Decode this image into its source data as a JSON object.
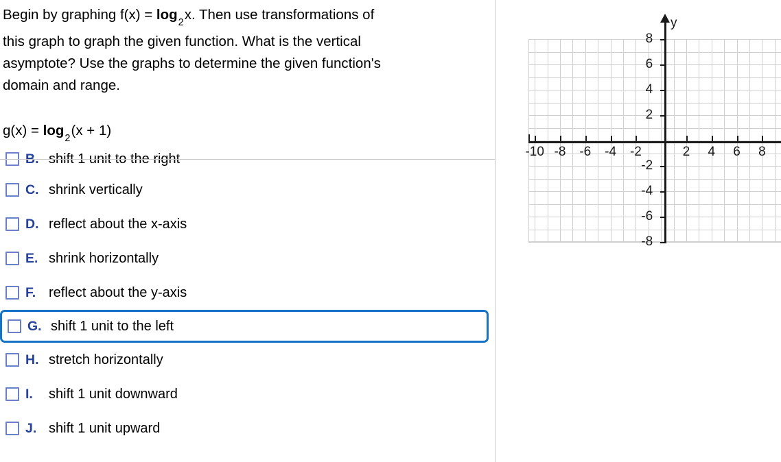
{
  "question": {
    "lines": [
      "Begin by graphing f(x) = ",
      "log",
      "2",
      "x. Then use transformations of",
      "this graph to graph the given function. What is the vertical",
      "asymptote? Use the graphs to determine the given function's",
      "domain and range."
    ],
    "line1_a": "Begin by graphing f(x) = ",
    "line1_log": "log",
    "line1_sub": "2",
    "line1_b": "x. Then use transformations of",
    "line2": "this graph to graph the given function. What is the vertical",
    "line3": "asymptote? Use the graphs to determine the given function's",
    "line4": "domain and range."
  },
  "given_function": {
    "prefix": "g(x) = ",
    "log": "log",
    "base": "2",
    "suffix": "(x + 1)"
  },
  "options": [
    {
      "letter": "B.",
      "label": "shift 1 unit to the right",
      "checked": false,
      "highlighted": false,
      "clipped": true
    },
    {
      "letter": "C.",
      "label": "shrink vertically",
      "checked": false,
      "highlighted": false,
      "clipped": false
    },
    {
      "letter": "D.",
      "label": "reflect about the x-axis",
      "checked": false,
      "highlighted": false,
      "clipped": false
    },
    {
      "letter": "E.",
      "label": "shrink horizontally",
      "checked": false,
      "highlighted": false,
      "clipped": false
    },
    {
      "letter": "F.",
      "label": "reflect about the y-axis",
      "checked": false,
      "highlighted": false,
      "clipped": false
    },
    {
      "letter": "G.",
      "label": "shift 1 unit to the left",
      "checked": false,
      "highlighted": true,
      "clipped": false
    },
    {
      "letter": "H.",
      "label": "stretch horizontally",
      "checked": false,
      "highlighted": false,
      "clipped": false
    },
    {
      "letter": "I.",
      "label": "shift 1 unit downward",
      "checked": false,
      "highlighted": false,
      "clipped": false
    },
    {
      "letter": "J.",
      "label": "shift 1 unit upward",
      "checked": false,
      "highlighted": false,
      "clipped": false
    }
  ],
  "colors": {
    "option_letter": "#27429b",
    "checkbox_border": "#6d7fc9",
    "highlight_border": "#1473c4",
    "grid_line": "#cfcfcf",
    "axis": "#1a1a1a",
    "divider": "#c9c9c9"
  },
  "chart_data": {
    "type": "line",
    "title": "",
    "xlabel": "",
    "ylabel": "y",
    "y_axis_label": "y",
    "xlim": [
      -10.5,
      9.5
    ],
    "ylim": [
      -8,
      8
    ],
    "x_ticks": [
      -10,
      -8,
      -6,
      -4,
      -2,
      2,
      4,
      6,
      8
    ],
    "x_tick_labels": [
      "-10",
      "-8",
      "-6",
      "-4",
      "-2",
      "2",
      "4",
      "6",
      "8"
    ],
    "y_ticks": [
      8,
      6,
      4,
      2,
      -2,
      -4,
      -6,
      -8
    ],
    "y_tick_labels": [
      "8",
      "6",
      "4",
      "2",
      "-2",
      "-4",
      "-6",
      "-8"
    ],
    "grid": true,
    "grid_step": 1,
    "series": [],
    "annotations": [],
    "note": "Empty coordinate plane with no plotted curve"
  }
}
